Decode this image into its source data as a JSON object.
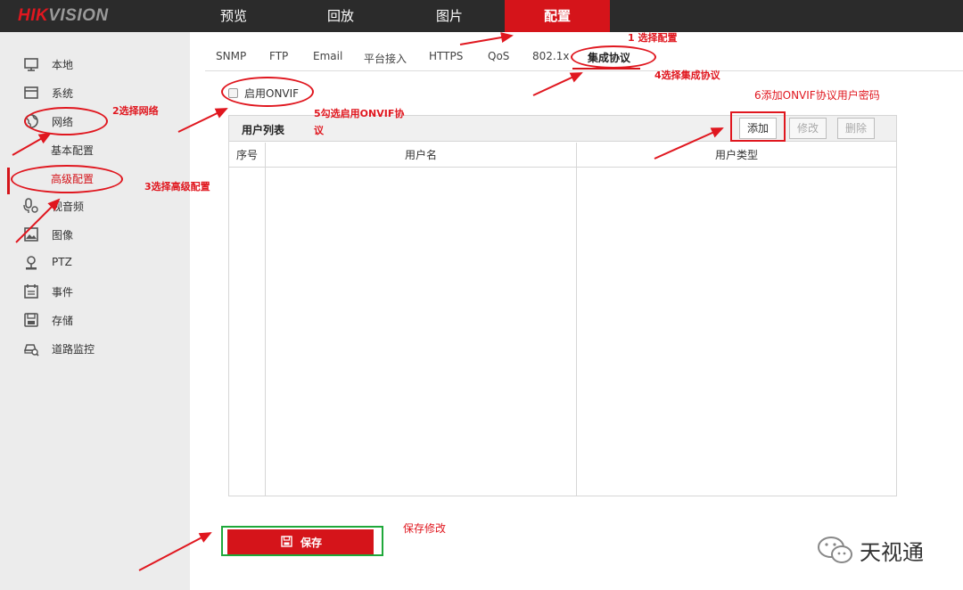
{
  "header": {
    "logo_mark": "HIK",
    "logo_rest": "VISION",
    "tabs": [
      {
        "label": "预览"
      },
      {
        "label": "回放"
      },
      {
        "label": "图片"
      },
      {
        "label": "配置",
        "active": true
      }
    ],
    "accent_color": "#d5141a"
  },
  "sidebar": {
    "items": [
      {
        "label": "本地",
        "icon": "monitor-icon"
      },
      {
        "label": "系统",
        "icon": "window-icon"
      },
      {
        "label": "网络",
        "icon": "globe-icon"
      },
      {
        "label": "基本配置",
        "sub": true
      },
      {
        "label": "高级配置",
        "sub": true,
        "active": true
      },
      {
        "label": "视音频",
        "icon": "mic-icon"
      },
      {
        "label": "图像",
        "icon": "image-icon"
      },
      {
        "label": "PTZ",
        "icon": "ptz-icon"
      },
      {
        "label": "事件",
        "icon": "calendar-icon"
      },
      {
        "label": "存储",
        "icon": "disk-icon"
      },
      {
        "label": "道路监控",
        "icon": "car-search-icon"
      }
    ]
  },
  "subtabs": [
    {
      "label": "SNMP"
    },
    {
      "label": "FTP"
    },
    {
      "label": "Email"
    },
    {
      "label": "平台接入"
    },
    {
      "label": "HTTPS"
    },
    {
      "label": "QoS"
    },
    {
      "label": "802.1x"
    },
    {
      "label": "集成协议",
      "active": true
    }
  ],
  "onvif": {
    "label": "启用ONVIF",
    "checked": false
  },
  "user_list": {
    "title": "用户列表",
    "buttons": {
      "add": "添加",
      "edit": "修改",
      "delete": "删除"
    },
    "columns": [
      "序号",
      "用户名",
      "用户类型"
    ],
    "rows": []
  },
  "save": {
    "label": "保存"
  },
  "annotations": {
    "step1": "1 选择配置",
    "step2": "2选择网络",
    "step3": "3选择高级配置",
    "step4": "4选择集成协议",
    "step5_line1": "5勾选启用ONVIF协",
    "step5_line2": "议",
    "step6": "6添加ONVIF协议用户密码",
    "save_note": "保存修改"
  },
  "watermark": {
    "label": "天视通"
  }
}
